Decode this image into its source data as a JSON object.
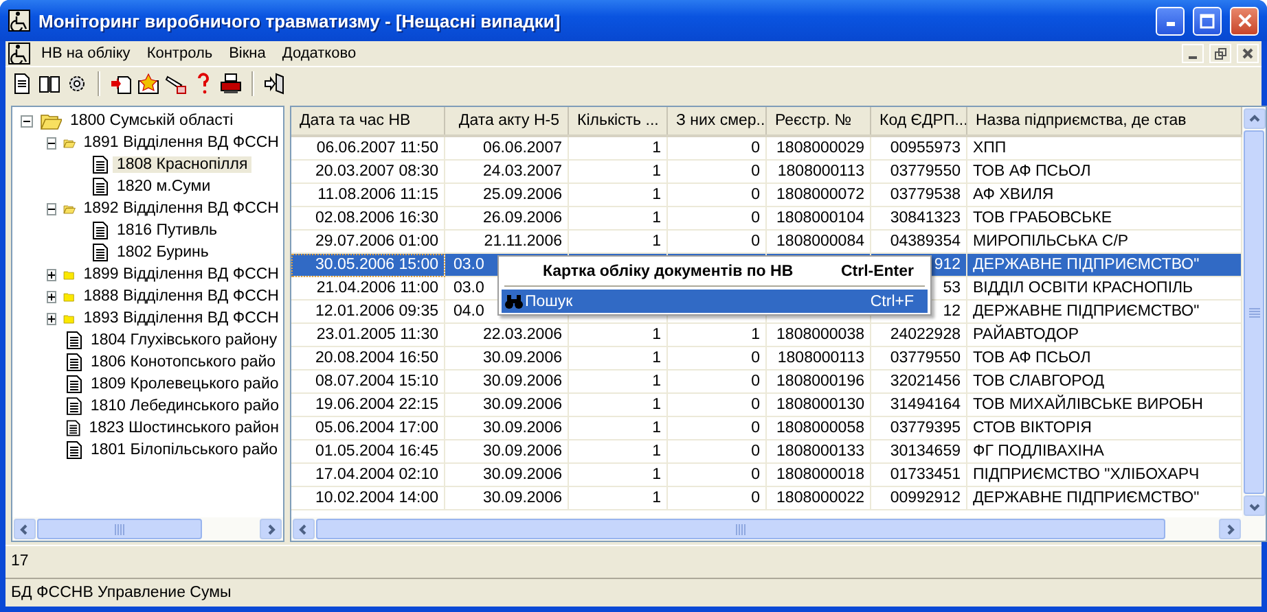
{
  "window": {
    "title": "Моніторинг виробничого травматизму - [Нещасні випадки]"
  },
  "menu": [
    "НВ на обліку",
    "Контроль",
    "Вікна",
    "Додатково"
  ],
  "tree": [
    {
      "label": "1800  Сумській області",
      "kind": "folder",
      "expanded": true,
      "selected": false,
      "children": [
        {
          "label": "1891 Відділення ВД ФССН",
          "kind": "folder",
          "expanded": true,
          "selected": false,
          "children": [
            {
              "label": "1808 Краснопілля",
              "kind": "doc",
              "selected": true
            },
            {
              "label": "1820 м.Суми",
              "kind": "doc",
              "selected": false
            }
          ]
        },
        {
          "label": "1892 Відділення ВД ФССН",
          "kind": "folder",
          "expanded": true,
          "selected": false,
          "children": [
            {
              "label": "1816 Путивль",
              "kind": "doc",
              "selected": false
            },
            {
              "label": "1802 Буринь",
              "kind": "doc",
              "selected": false
            }
          ]
        },
        {
          "label": "1899 Відділення ВД ФССН",
          "kind": "folder",
          "expanded": false,
          "selected": false
        },
        {
          "label": "1888 Відділення ВД ФССН",
          "kind": "folder",
          "expanded": false,
          "selected": false
        },
        {
          "label": "1893 Відділення ВД ФССН",
          "kind": "folder",
          "expanded": false,
          "selected": false
        },
        {
          "label": "1804 Глухівського району",
          "kind": "doc",
          "selected": false
        },
        {
          "label": "1806 Конотопського райо",
          "kind": "doc",
          "selected": false
        },
        {
          "label": "1809 Кролевецького райо",
          "kind": "doc",
          "selected": false
        },
        {
          "label": "1810 Лебединського райо",
          "kind": "doc",
          "selected": false
        },
        {
          "label": "1823 Шостинського район",
          "kind": "doc",
          "selected": false
        },
        {
          "label": "1801 Білопільського райо",
          "kind": "doc",
          "selected": false
        }
      ]
    }
  ],
  "table": {
    "columns": [
      "Дата та час НВ",
      "Дата акту Н-5",
      "Кількість ...",
      "З них смер...",
      "Реєстр. №",
      "Код ЄДРП...",
      "Назва підприємства, де став"
    ],
    "rows": [
      {
        "selected": false,
        "covered": false,
        "cells": [
          "06.06.2007 11:50",
          "06.06.2007",
          "1",
          "0",
          "1808000029",
          "00955973",
          "ХПП"
        ]
      },
      {
        "selected": false,
        "covered": false,
        "cells": [
          "20.03.2007 08:30",
          "24.03.2007",
          "1",
          "0",
          "1808000113",
          "03779550",
          "ТОВ АФ ПСЬОЛ"
        ]
      },
      {
        "selected": false,
        "covered": false,
        "cells": [
          "11.08.2006 11:15",
          "25.09.2006",
          "1",
          "0",
          "1808000072",
          "03779538",
          "АФ ХВИЛЯ"
        ]
      },
      {
        "selected": false,
        "covered": false,
        "cells": [
          "02.08.2006 16:30",
          "26.09.2006",
          "1",
          "0",
          "1808000104",
          "30841323",
          "ТОВ ГРАБОВСЬКЕ"
        ]
      },
      {
        "selected": false,
        "covered": false,
        "cells": [
          "29.07.2006 01:00",
          "21.11.2006",
          "1",
          "0",
          "1808000084",
          "04389354",
          "МИРОПІЛЬСЬКА С/Р"
        ]
      },
      {
        "selected": true,
        "covered": true,
        "cells": [
          "30.05.2006 15:00",
          "03.0",
          "",
          "",
          "",
          "912",
          "ДЕРЖАВНЕ ПІДПРИЄМСТВО\""
        ]
      },
      {
        "selected": false,
        "covered": true,
        "cells": [
          "21.04.2006 11:00",
          "03.0",
          "",
          "",
          "",
          "53",
          "ВІДДІЛ ОСВІТИ КРАСНОПІЛЬ"
        ]
      },
      {
        "selected": false,
        "covered": true,
        "cells": [
          "12.01.2006 09:35",
          "04.0",
          "",
          "",
          "",
          "12",
          "ДЕРЖАВНЕ ПІДПРИЄМСТВО\""
        ]
      },
      {
        "selected": false,
        "covered": false,
        "cells": [
          "23.01.2005 11:30",
          "22.03.2006",
          "1",
          "1",
          "1808000038",
          "24022928",
          "РАЙАВТОДОР"
        ]
      },
      {
        "selected": false,
        "covered": false,
        "cells": [
          "20.08.2004 16:50",
          "30.09.2006",
          "1",
          "0",
          "1808000113",
          "03779550",
          "ТОВ АФ ПСЬОЛ"
        ]
      },
      {
        "selected": false,
        "covered": false,
        "cells": [
          "08.07.2004 15:10",
          "30.09.2006",
          "1",
          "0",
          "1808000196",
          "32021456",
          "ТОВ СЛАВГОРОД"
        ]
      },
      {
        "selected": false,
        "covered": false,
        "cells": [
          "19.06.2004 22:15",
          "30.09.2006",
          "1",
          "0",
          "1808000130",
          "31494164",
          "ТОВ МИХАЙЛІВСЬКЕ ВИРОБН"
        ]
      },
      {
        "selected": false,
        "covered": false,
        "cells": [
          "05.06.2004 17:00",
          "30.09.2006",
          "1",
          "0",
          "1808000058",
          "03779395",
          "СТОВ ВІКТОРІЯ"
        ]
      },
      {
        "selected": false,
        "covered": false,
        "cells": [
          "01.05.2004 16:45",
          "30.09.2006",
          "1",
          "0",
          "1808000133",
          "30134659",
          "ФГ ПОДЛІВАХІНА"
        ]
      },
      {
        "selected": false,
        "covered": false,
        "cells": [
          "17.04.2004 02:10",
          "30.09.2006",
          "1",
          "0",
          "1808000018",
          "01733451",
          "ПІДПРИЄМСТВО  \"ХЛІБОХАРЧ"
        ]
      },
      {
        "selected": false,
        "covered": false,
        "cells": [
          "10.02.2004 14:00",
          "30.09.2006",
          "1",
          "0",
          "1808000022",
          "00992912",
          "ДЕРЖАВНЕ ПІДПРИЄМСТВО\""
        ]
      }
    ]
  },
  "context_menu": [
    {
      "label": "Картка обліку документів по НВ",
      "shortcut": "Ctrl-Enter",
      "kind": "default",
      "selected": false
    },
    {
      "label": "Пошук",
      "shortcut": "Ctrl+F",
      "kind": "search",
      "selected": true
    }
  ],
  "record_count": "17",
  "status_bar": "БД ФССНВ Управление Сумы"
}
